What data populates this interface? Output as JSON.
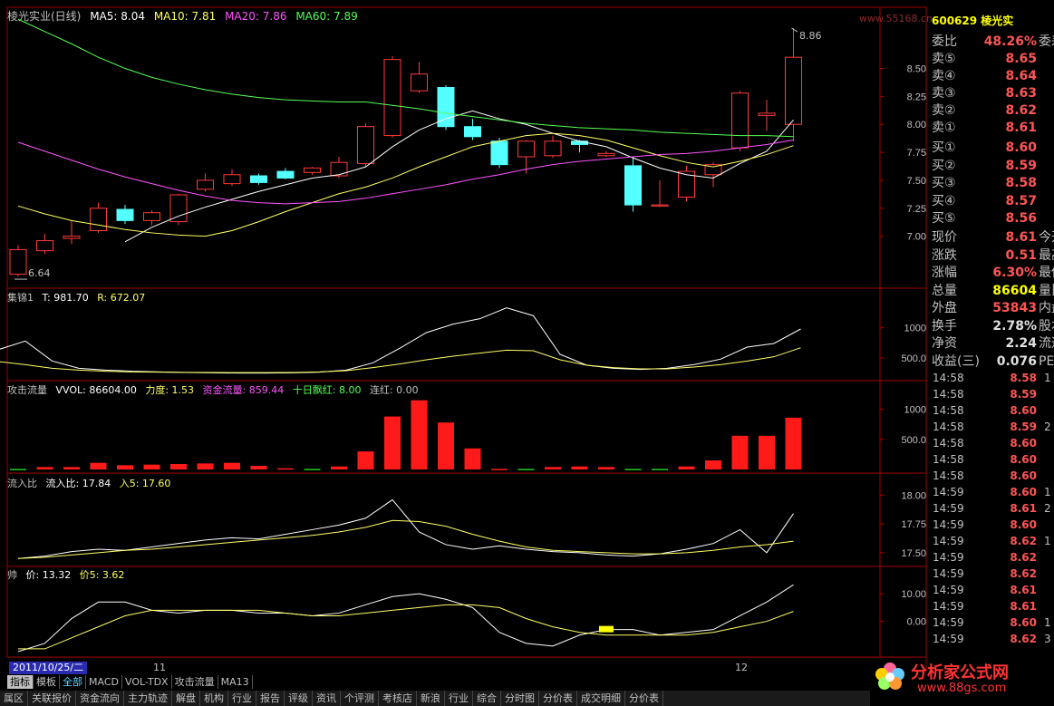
{
  "header": {
    "stock_name": "棱光实业(日线)",
    "ma_items": [
      {
        "label": "MA5: 8.04",
        "color": "#ffffff"
      },
      {
        "label": "MA10: 7.81",
        "color": "#ffff66"
      },
      {
        "label": "MA20: 7.86",
        "color": "#ff55ff"
      },
      {
        "label": "MA60: 7.89",
        "color": "#55ff55"
      }
    ],
    "watermark": "www.55168.cn",
    "stock_code": "600629",
    "stock_short": "棱光实"
  },
  "price_axis": [
    "8.50",
    "8.25",
    "8.00",
    "7.75",
    "7.50",
    "7.25",
    "7.00"
  ],
  "high_label": "8.86",
  "low_label": "6.64",
  "indicator_jijin": {
    "title": "集锦1",
    "t": "T: 981.70",
    "r": "R: 672.07",
    "axis": [
      "1000",
      "500.0"
    ]
  },
  "indicator_gongji": {
    "title": "攻击流量",
    "vvol": "VVOL: 86604.00",
    "lidu": "力度: 1.53",
    "zijin": "资金流量: 859.44",
    "shiri": "十日飘红: 8.00",
    "lianhong": "连红: 0.00",
    "axis": [
      "1000",
      "500.0"
    ]
  },
  "indicator_liuru": {
    "title": "流入比",
    "val": "流入比: 17.84",
    "ru5": "入5: 17.60",
    "axis": [
      "18.00",
      "17.75",
      "17.50"
    ]
  },
  "indicator_shuai": {
    "title": "帅",
    "jia": "价: 13.32",
    "jia5": "价5: 3.62",
    "axis": [
      "10.00",
      "0.00"
    ]
  },
  "date_axis": {
    "cursor_date": "2011/10/25/二",
    "month_11": "11",
    "month_12": "12"
  },
  "order_book": {
    "weibi_label": "委比",
    "weibi_value": "48.26%",
    "weicha_label": "委差",
    "sell": [
      {
        "label": "卖⑤",
        "price": "8.65"
      },
      {
        "label": "卖④",
        "price": "8.64"
      },
      {
        "label": "卖③",
        "price": "8.63"
      },
      {
        "label": "卖②",
        "price": "8.62"
      },
      {
        "label": "卖①",
        "price": "8.61"
      }
    ],
    "buy": [
      {
        "label": "买①",
        "price": "8.60"
      },
      {
        "label": "买②",
        "price": "8.59"
      },
      {
        "label": "买③",
        "price": "8.58"
      },
      {
        "label": "买④",
        "price": "8.57"
      },
      {
        "label": "买⑤",
        "price": "8.56"
      }
    ]
  },
  "quote": [
    {
      "label": "现价",
      "value": "8.61",
      "color": "#ff5555",
      "ext": "今开"
    },
    {
      "label": "涨跌",
      "value": "0.51",
      "color": "#ff5555",
      "ext": "最高"
    },
    {
      "label": "涨幅",
      "value": "6.30%",
      "color": "#ff5555",
      "ext": "最低"
    },
    {
      "label": "总量",
      "value": "86604",
      "color": "#ffff00",
      "ext": "量比"
    },
    {
      "label": "外盘",
      "value": "53843",
      "color": "#ff5555",
      "ext": "内盘"
    },
    {
      "label": "换手",
      "value": "2.78%",
      "color": "#e0e0e0",
      "ext": "股本"
    },
    {
      "label": "净资",
      "value": "2.24",
      "color": "#e0e0e0",
      "ext": "流通"
    },
    {
      "label": "收益(三)",
      "value": "0.076",
      "color": "#e0e0e0",
      "ext": "PE(动"
    }
  ],
  "ticks": [
    {
      "time": "14:58",
      "price": "8.58",
      "vol": "1"
    },
    {
      "time": "14:58",
      "price": "8.59",
      "vol": ""
    },
    {
      "time": "14:58",
      "price": "8.60",
      "vol": ""
    },
    {
      "time": "14:58",
      "price": "8.59",
      "vol": "2"
    },
    {
      "time": "14:58",
      "price": "8.60",
      "vol": ""
    },
    {
      "time": "14:58",
      "price": "8.60",
      "vol": ""
    },
    {
      "time": "14:58",
      "price": "8.60",
      "vol": ""
    },
    {
      "time": "14:59",
      "price": "8.60",
      "vol": "1"
    },
    {
      "time": "14:59",
      "price": "8.61",
      "vol": "2"
    },
    {
      "time": "14:59",
      "price": "8.60",
      "vol": ""
    },
    {
      "time": "14:59",
      "price": "8.62",
      "vol": "1"
    },
    {
      "time": "14:59",
      "price": "8.62",
      "vol": ""
    },
    {
      "time": "14:59",
      "price": "8.62",
      "vol": ""
    },
    {
      "time": "14:59",
      "price": "8.61",
      "vol": ""
    },
    {
      "time": "14:59",
      "price": "8.61",
      "vol": ""
    },
    {
      "time": "14:59",
      "price": "8.60",
      "vol": "1"
    },
    {
      "time": "14:59",
      "price": "8.62",
      "vol": "3"
    }
  ],
  "bottom_tabs": [
    {
      "label": "指标",
      "state": "sel"
    },
    {
      "label": "模板",
      "state": ""
    },
    {
      "label": "全部",
      "state": "blue"
    },
    {
      "label": "MACD",
      "state": ""
    },
    {
      "label": "VOL-TDX",
      "state": ""
    },
    {
      "label": "攻击流量",
      "state": ""
    },
    {
      "label": "MA13",
      "state": ""
    }
  ],
  "bottom_menu": [
    "属区",
    "关联报价",
    "资金流向",
    "主力轨迹",
    "解盘",
    "机构",
    "行业",
    "报告",
    "评级",
    "资讯",
    "个评测",
    "考核店",
    "新浪",
    "行业",
    "综合",
    "分时图",
    "分价表",
    "成交明细",
    "分价表"
  ],
  "logo": {
    "title": "分析家公式网",
    "url": "www.88gs.com"
  },
  "chart_data": {
    "type": "candlestick",
    "title": "棱光实业(日线)",
    "candles": [
      {
        "o": 6.66,
        "c": 6.88,
        "h": 6.92,
        "l": 6.64
      },
      {
        "o": 6.87,
        "c": 6.96,
        "h": 7.02,
        "l": 6.84
      },
      {
        "o": 6.98,
        "c": 7.0,
        "h": 7.14,
        "l": 6.93
      },
      {
        "o": 7.05,
        "c": 7.25,
        "h": 7.3,
        "l": 7.03
      },
      {
        "o": 7.24,
        "c": 7.14,
        "h": 7.28,
        "l": 7.11
      },
      {
        "o": 7.14,
        "c": 7.21,
        "h": 7.23,
        "l": 7.1
      },
      {
        "o": 7.13,
        "c": 7.37,
        "h": 7.38,
        "l": 7.1
      },
      {
        "o": 7.42,
        "c": 7.5,
        "h": 7.56,
        "l": 7.4
      },
      {
        "o": 7.47,
        "c": 7.55,
        "h": 7.6,
        "l": 7.45
      },
      {
        "o": 7.54,
        "c": 7.48,
        "h": 7.56,
        "l": 7.46
      },
      {
        "o": 7.58,
        "c": 7.52,
        "h": 7.61,
        "l": 7.51
      },
      {
        "o": 7.57,
        "c": 7.61,
        "h": 7.62,
        "l": 7.55
      },
      {
        "o": 7.54,
        "c": 7.66,
        "h": 7.71,
        "l": 7.52
      },
      {
        "o": 7.65,
        "c": 7.98,
        "h": 8.01,
        "l": 7.62
      },
      {
        "o": 7.9,
        "c": 8.58,
        "h": 8.61,
        "l": 7.88
      },
      {
        "o": 8.3,
        "c": 8.45,
        "h": 8.56,
        "l": 8.28
      },
      {
        "o": 8.33,
        "c": 7.98,
        "h": 8.35,
        "l": 7.95
      },
      {
        "o": 7.98,
        "c": 7.89,
        "h": 8.05,
        "l": 7.86
      },
      {
        "o": 7.85,
        "c": 7.64,
        "h": 7.88,
        "l": 7.61
      },
      {
        "o": 7.71,
        "c": 7.85,
        "h": 7.86,
        "l": 7.56
      },
      {
        "o": 7.72,
        "c": 7.85,
        "h": 7.9,
        "l": 7.7
      },
      {
        "o": 7.85,
        "c": 7.82,
        "h": 7.86,
        "l": 7.75
      },
      {
        "o": 7.72,
        "c": 7.74,
        "h": 7.76,
        "l": 7.71
      },
      {
        "o": 7.63,
        "c": 7.28,
        "h": 7.71,
        "l": 7.22
      },
      {
        "o": 7.27,
        "c": 7.28,
        "h": 7.5,
        "l": 7.26
      },
      {
        "o": 7.35,
        "c": 7.58,
        "h": 7.63,
        "l": 7.31
      },
      {
        "o": 7.55,
        "c": 7.64,
        "h": 7.66,
        "l": 7.44
      },
      {
        "o": 7.79,
        "c": 8.28,
        "h": 8.3,
        "l": 7.76
      },
      {
        "o": 8.08,
        "c": 8.1,
        "h": 8.22,
        "l": 7.94
      },
      {
        "o": 8.0,
        "c": 8.6,
        "h": 8.86,
        "l": 7.85
      }
    ],
    "ma": [
      {
        "name": "MA5",
        "values": [
          null,
          null,
          null,
          null,
          6.95,
          7.08,
          7.18,
          7.26,
          7.33,
          7.4,
          7.46,
          7.52,
          7.55,
          7.62,
          7.8,
          7.95,
          8.05,
          8.12,
          8.05,
          8.0,
          7.92,
          7.85,
          7.8,
          7.7,
          7.61,
          7.55,
          7.52,
          7.65,
          7.76,
          8.04
        ]
      },
      {
        "name": "MA10",
        "values": [
          7.27,
          7.2,
          7.14,
          7.1,
          7.06,
          7.03,
          7.01,
          7.0,
          7.05,
          7.13,
          7.22,
          7.3,
          7.38,
          7.44,
          7.52,
          7.62,
          7.71,
          7.8,
          7.85,
          7.9,
          7.92,
          7.9,
          7.86,
          7.79,
          7.72,
          7.66,
          7.62,
          7.67,
          7.73,
          7.81
        ]
      },
      {
        "name": "MA20",
        "values": [
          7.84,
          7.76,
          7.68,
          7.6,
          7.53,
          7.47,
          7.41,
          7.36,
          7.32,
          7.3,
          7.29,
          7.3,
          7.31,
          7.34,
          7.38,
          7.42,
          7.46,
          7.51,
          7.55,
          7.6,
          7.64,
          7.67,
          7.69,
          7.71,
          7.73,
          7.74,
          7.76,
          7.79,
          7.82,
          7.86
        ]
      },
      {
        "name": "MA60",
        "values": [
          8.94,
          8.83,
          8.72,
          8.6,
          8.5,
          8.42,
          8.36,
          8.31,
          8.27,
          8.24,
          8.22,
          8.21,
          8.2,
          8.2,
          8.17,
          8.14,
          8.1,
          8.07,
          8.04,
          8.01,
          7.99,
          7.97,
          7.96,
          7.95,
          7.93,
          7.92,
          7.91,
          7.9,
          7.9,
          7.89
        ]
      }
    ],
    "indicator_jijin": {
      "t": [
        640,
        780,
        450,
        330,
        300,
        280,
        270,
        260,
        255,
        250,
        250,
        255,
        265,
        300,
        420,
        660,
        920,
        1060,
        1150,
        1330,
        1200,
        560,
        380,
        330,
        310,
        330,
        390,
        480,
        680,
        740,
        980
      ],
      "r": [
        440,
        390,
        330,
        300,
        280,
        270,
        265,
        262,
        260,
        258,
        258,
        260,
        270,
        290,
        340,
        400,
        470,
        530,
        580,
        630,
        620,
        470,
        380,
        340,
        320,
        320,
        350,
        390,
        450,
        520,
        670
      ]
    },
    "indicator_gongji": {
      "bars": [
        10,
        40,
        40,
        110,
        70,
        80,
        90,
        100,
        110,
        60,
        20,
        10,
        50,
        300,
        880,
        1150,
        780,
        350,
        10,
        10,
        40,
        50,
        40,
        10,
        10,
        50,
        150,
        560,
        560,
        860
      ],
      "colors": [
        "g",
        "r",
        "r",
        "r",
        "r",
        "r",
        "r",
        "r",
        "r",
        "r",
        "r",
        "g",
        "r",
        "r",
        "r",
        "r",
        "r",
        "r",
        "r",
        "g",
        "r",
        "r",
        "r",
        "g",
        "g",
        "r",
        "r",
        "r",
        "r",
        "r"
      ]
    },
    "indicator_liuru": {
      "flow": [
        17.45,
        17.47,
        17.51,
        17.53,
        17.52,
        17.55,
        17.58,
        17.61,
        17.63,
        17.62,
        17.66,
        17.7,
        17.74,
        17.8,
        17.96,
        17.68,
        17.57,
        17.53,
        17.56,
        17.53,
        17.51,
        17.5,
        17.48,
        17.47,
        17.49,
        17.53,
        17.58,
        17.7,
        17.5,
        17.84
      ],
      "in5": [
        17.45,
        17.46,
        17.48,
        17.5,
        17.52,
        17.53,
        17.55,
        17.57,
        17.59,
        17.61,
        17.63,
        17.65,
        17.68,
        17.72,
        17.78,
        17.77,
        17.73,
        17.66,
        17.6,
        17.55,
        17.52,
        17.51,
        17.5,
        17.49,
        17.49,
        17.5,
        17.52,
        17.55,
        17.57,
        17.6
      ]
    },
    "indicator_shuai": {
      "price": [
        -11,
        -8,
        1,
        7,
        7,
        4,
        3,
        4,
        4,
        3,
        3,
        2,
        3,
        6,
        9,
        10,
        8,
        5,
        -4,
        -8,
        -9,
        -5,
        -3,
        -3,
        -5,
        -4,
        -3,
        2,
        7,
        13.3
      ],
      "price5": [
        -10,
        -10,
        -6,
        -2,
        2,
        4,
        4,
        4,
        4,
        4,
        3,
        2,
        2,
        3,
        4,
        5,
        6,
        6,
        5,
        1,
        -2,
        -4,
        -5,
        -5,
        -5,
        -5,
        -4,
        -2,
        0,
        3.6
      ]
    }
  }
}
